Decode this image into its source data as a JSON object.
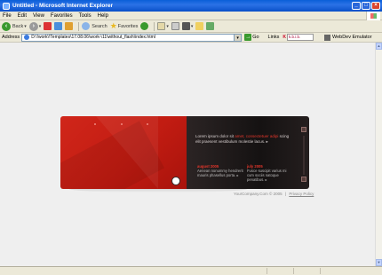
{
  "window": {
    "title": "Untitled - Microsoft Internet Explorer",
    "controls": [
      "_",
      "□",
      "×"
    ]
  },
  "menu": [
    "File",
    "Edit",
    "View",
    "Favorites",
    "Tools",
    "Help"
  ],
  "toolbar": {
    "back_label": "Back",
    "search_label": "Search",
    "favorites_label": "Favorites"
  },
  "address": {
    "label": "Address",
    "value": "D:\\!work\\!Templates\\17.08.06\\work-\\11\\without_flash\\index.html",
    "go_label": "Go",
    "links_label": "Links",
    "tool_value": "k.b.i.b.",
    "emulator_label": "WebDev Emulator"
  },
  "banner": {
    "intro_text": "Lorem ipsum dolor sit",
    "intro_highlight": "amet, consectetuer adipi",
    "intro_rest": "scing elit praesent vestibulum molestie lacus. ▸",
    "news": [
      {
        "date": "august 2005",
        "text": "Aenean nonummy hendrerit mauris phasellus porta. ▸"
      },
      {
        "date": "july 2005",
        "text": "Fusce suscipit varius mi cum sociis natoque penatibus. ▸"
      }
    ]
  },
  "footer": {
    "copyright": "YourCompany.Com © 2005",
    "separator": "|",
    "privacy": "Privacy Policy"
  },
  "colors": {
    "red": "#c21c12",
    "dark": "#151212",
    "accent": "#e4362b"
  }
}
